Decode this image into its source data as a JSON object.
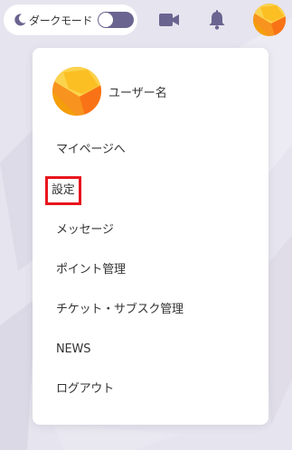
{
  "topbar": {
    "dark_mode_label": "ダークモード",
    "dark_mode_on": false,
    "icons": [
      "moon-icon",
      "video-icon",
      "bell-icon",
      "avatar"
    ]
  },
  "menu": {
    "username": "ユーザー名",
    "items": [
      {
        "label": "マイページへ"
      },
      {
        "label": "設定",
        "highlighted": true
      },
      {
        "label": "メッセージ"
      },
      {
        "label": "ポイント管理"
      },
      {
        "label": "チケット・サブスク管理"
      },
      {
        "label": "NEWS"
      },
      {
        "label": "ログアウト"
      }
    ]
  },
  "colors": {
    "background": "#e6e4ee",
    "icon": "#6a6490",
    "highlight_border": "#e8141d",
    "avatar_orange": "#f7931e",
    "avatar_yellow": "#fcd34d"
  }
}
